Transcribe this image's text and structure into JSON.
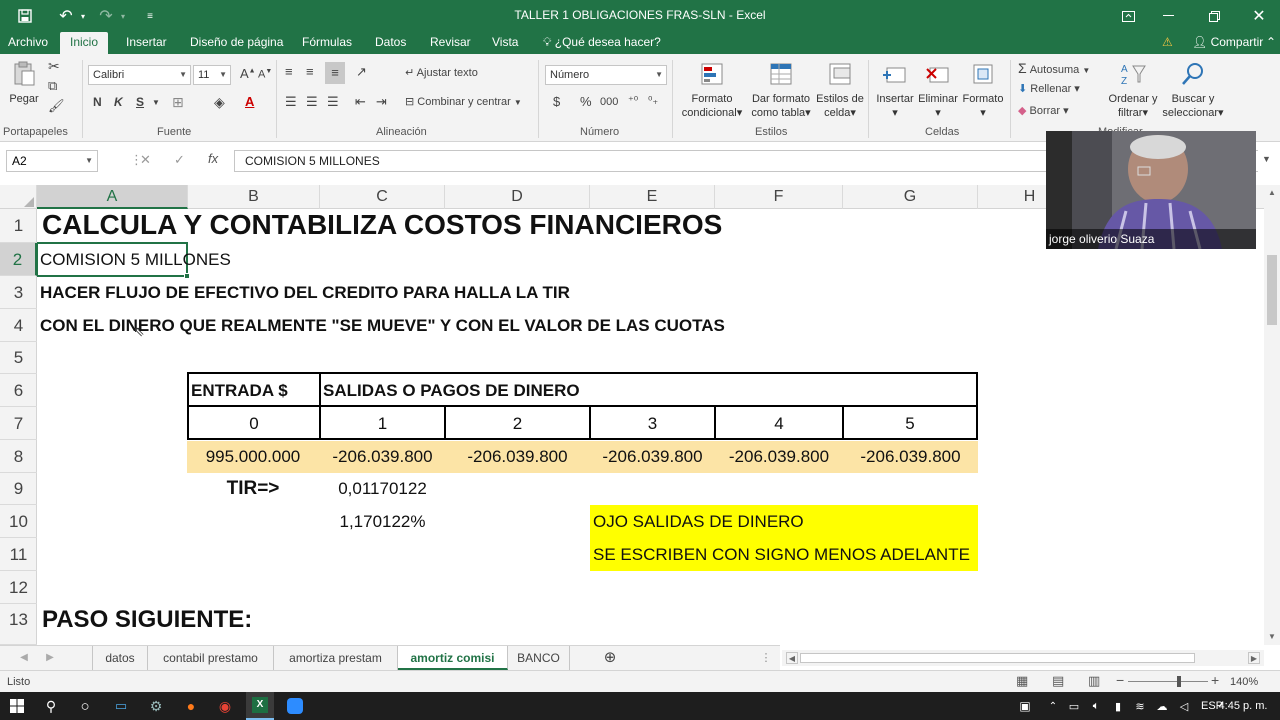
{
  "window": {
    "title": "TALLER 1 OBLIGACIONES FRAS-SLN - Excel"
  },
  "menu": {
    "tabs": [
      "Archivo",
      "Inicio",
      "Insertar",
      "Diseño de página",
      "Fórmulas",
      "Datos",
      "Revisar",
      "Vista"
    ],
    "active_tab": "Inicio",
    "tell_me": "¿Qué desea hacer?",
    "share": "Compartir"
  },
  "ribbon": {
    "paste": "Pegar",
    "clipboard_label": "Portapapeles",
    "font_name": "Calibri",
    "font_size": "11",
    "font_label": "Fuente",
    "bold": "N",
    "italic": "K",
    "underline": "S",
    "wrap_text": "Ajustar texto",
    "merge_center": "Combinar y centrar",
    "alignment_label": "Alineación",
    "number_format": "Número",
    "number_label": "Número",
    "currency": "$",
    "percent": "%",
    "thousands": "000",
    "cond_format": [
      "Formato",
      "condicional"
    ],
    "format_table": [
      "Dar formato",
      "como tabla"
    ],
    "cell_styles": [
      "Estilos de",
      "celda"
    ],
    "styles_label": "Estilos",
    "insert": "Insertar",
    "delete": "Eliminar",
    "format": "Formato",
    "cells_label": "Celdas",
    "autosum": "Autosuma",
    "fill": "Rellenar",
    "clear": "Borrar",
    "sort_filter": [
      "Ordenar y",
      "filtrar"
    ],
    "find_select": [
      "Buscar y",
      "seleccionar"
    ],
    "editing_label": "Modificar"
  },
  "formula_bar": {
    "name_box": "A2",
    "content": "COMISION 5 MILLONES"
  },
  "grid": {
    "columns": [
      "A",
      "B",
      "C",
      "D",
      "E",
      "F",
      "G",
      "H"
    ],
    "rows": [
      "1",
      "2",
      "3",
      "4",
      "5",
      "6",
      "7",
      "8",
      "9",
      "10",
      "11",
      "12",
      "13"
    ],
    "selected_col": "A",
    "selected_row": "2",
    "cells": {
      "a1": "CALCULA Y CONTABILIZA COSTOS FINANCIEROS",
      "a2": "COMISION 5 MILLONES",
      "a3": "HACER FLUJO DE EFECTIVO DEL CREDITO PARA HALLA LA TIR",
      "a4": "CON EL DINERO QUE REALMENTE \"SE MUEVE\" Y CON EL VALOR DE LAS CUOTAS",
      "b6": "ENTRADA $",
      "c6": "SALIDAS O PAGOS  DE DINERO",
      "b7": "0",
      "c7": "1",
      "d7": "2",
      "e7": "3",
      "f7": "4",
      "g7": "5",
      "b8": "995.000.000",
      "c8": "-206.039.800",
      "d8": "-206.039.800",
      "e8": "-206.039.800",
      "f8": "-206.039.800",
      "g8": "-206.039.800",
      "b9": "TIR=>",
      "c9": "0,01170122",
      "c10": "1,170122%",
      "e10": "OJO SALIDAS DE DINERO",
      "e11": "SE ESCRIBEN CON SIGNO MENOS ADELANTE",
      "a13": "PASO SIGUIENTE:"
    }
  },
  "sheets": {
    "tabs": [
      "datos",
      "contabil prestamo",
      "amortiza prestam",
      "amortiz comisi",
      "BANCO"
    ],
    "active": "amortiz comisi"
  },
  "status": {
    "ready": "Listo",
    "zoom": "140%"
  },
  "taskbar": {
    "language": "ESP",
    "time": "4:45 p. m."
  },
  "video": {
    "name": "jorge oliverio Suaza"
  },
  "colors": {
    "excel_green": "#217346",
    "cashflow_fill": "#fce4a6",
    "note_fill": "#ffff00"
  }
}
